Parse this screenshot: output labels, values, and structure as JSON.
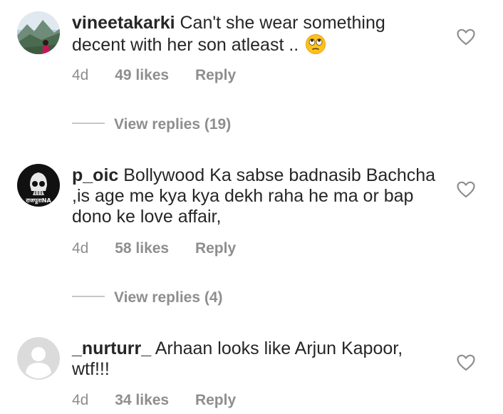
{
  "comments": [
    {
      "username": "vineetakarki",
      "text": "Can't she wear something decent with her son atleast ..",
      "emoji": "face-with-rolling-eyes-emoji",
      "time": "4d",
      "likes": "49 likes",
      "reply_label": "Reply",
      "view_replies": "View replies (19)",
      "avatar": "landscape-photo-avatar"
    },
    {
      "username": "p_oic",
      "text": "Bollywood Ka sabse badnasib Bachcha ,is age me kya kya dekh raha he ma or bap dono ke love affair,",
      "time": "4d",
      "likes": "58 likes",
      "reply_label": "Reply",
      "view_replies": "View replies (4)",
      "avatar": "skull-logo-avatar",
      "avatar_text": "राजपूताNA"
    },
    {
      "username": "_nurturr_",
      "text": "Arhaan looks like Arjun Kapoor, wtf!!!",
      "time": "4d",
      "likes": "34 likes",
      "reply_label": "Reply",
      "avatar": "default-person-avatar"
    }
  ],
  "colors": {
    "text": "#262626",
    "secondary": "#8e8e8e",
    "divider": "#c7c7c7",
    "heart_outline": "#8e8e8e"
  },
  "icons": {
    "like": "heart-outline-icon"
  }
}
